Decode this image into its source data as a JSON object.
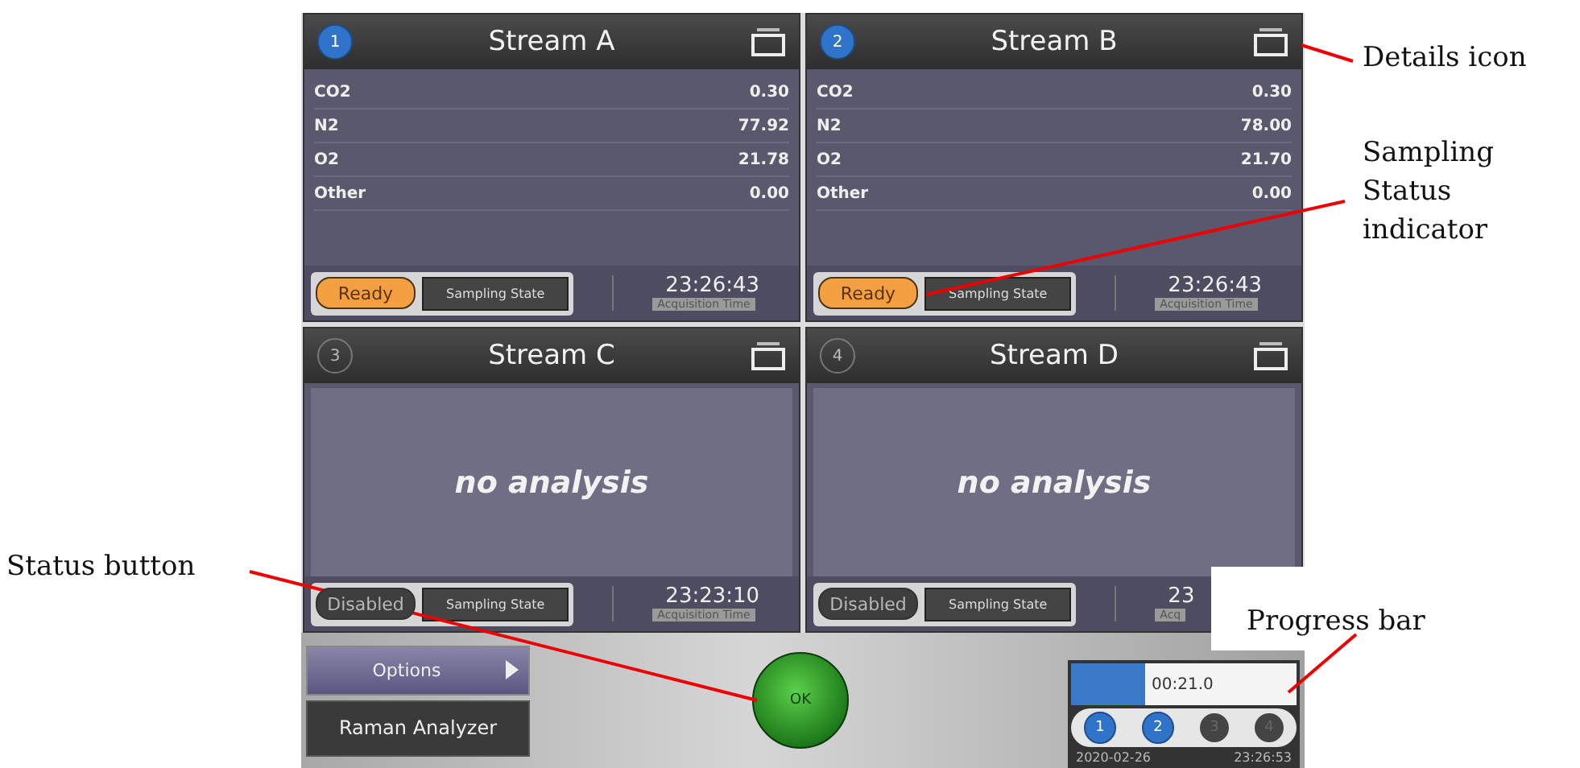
{
  "streams": [
    {
      "number": "1",
      "active": true,
      "title": "Stream A",
      "rows": [
        {
          "label": "CO2",
          "value": "0.30"
        },
        {
          "label": "N2",
          "value": "77.92"
        },
        {
          "label": "O2",
          "value": "21.78"
        },
        {
          "label": "Other",
          "value": "0.00"
        }
      ],
      "status": {
        "label": "Ready",
        "kind": "ready"
      },
      "sampling_label": "Sampling State",
      "time": "23:26:43",
      "time_label": "Acquisition Time"
    },
    {
      "number": "2",
      "active": true,
      "title": "Stream B",
      "rows": [
        {
          "label": "CO2",
          "value": "0.30"
        },
        {
          "label": "N2",
          "value": "78.00"
        },
        {
          "label": "O2",
          "value": "21.70"
        },
        {
          "label": "Other",
          "value": "0.00"
        }
      ],
      "status": {
        "label": "Ready",
        "kind": "ready"
      },
      "sampling_label": "Sampling State",
      "time": "23:26:43",
      "time_label": "Acquisition Time"
    },
    {
      "number": "3",
      "active": false,
      "title": "Stream C",
      "message": "no analysis",
      "status": {
        "label": "Disabled",
        "kind": "disabled"
      },
      "sampling_label": "Sampling State",
      "time": "23:23:10",
      "time_label": "Acquisition Time"
    },
    {
      "number": "4",
      "active": false,
      "title": "Stream D",
      "message": "no analysis",
      "status": {
        "label": "Disabled",
        "kind": "disabled"
      },
      "sampling_label": "Sampling State",
      "time": "23",
      "time_label": "Acq"
    }
  ],
  "bottom_bar": {
    "options_button": "Options",
    "analyzer_button": "Raman Analyzer",
    "status_button": "OK",
    "progress": {
      "level": 0.33,
      "time": "00:21.0",
      "steps": [
        {
          "label": "1",
          "done": true
        },
        {
          "label": "2",
          "done": true
        },
        {
          "label": "3",
          "done": false
        },
        {
          "label": "4",
          "done": false
        }
      ],
      "date": "2020-02-26",
      "clock": "23:26:53"
    }
  },
  "annotations": [
    {
      "text": "Details icon"
    },
    {
      "text": "Sampling Status indicator"
    },
    {
      "text": "Status button"
    },
    {
      "text": "Progress bar"
    }
  ]
}
